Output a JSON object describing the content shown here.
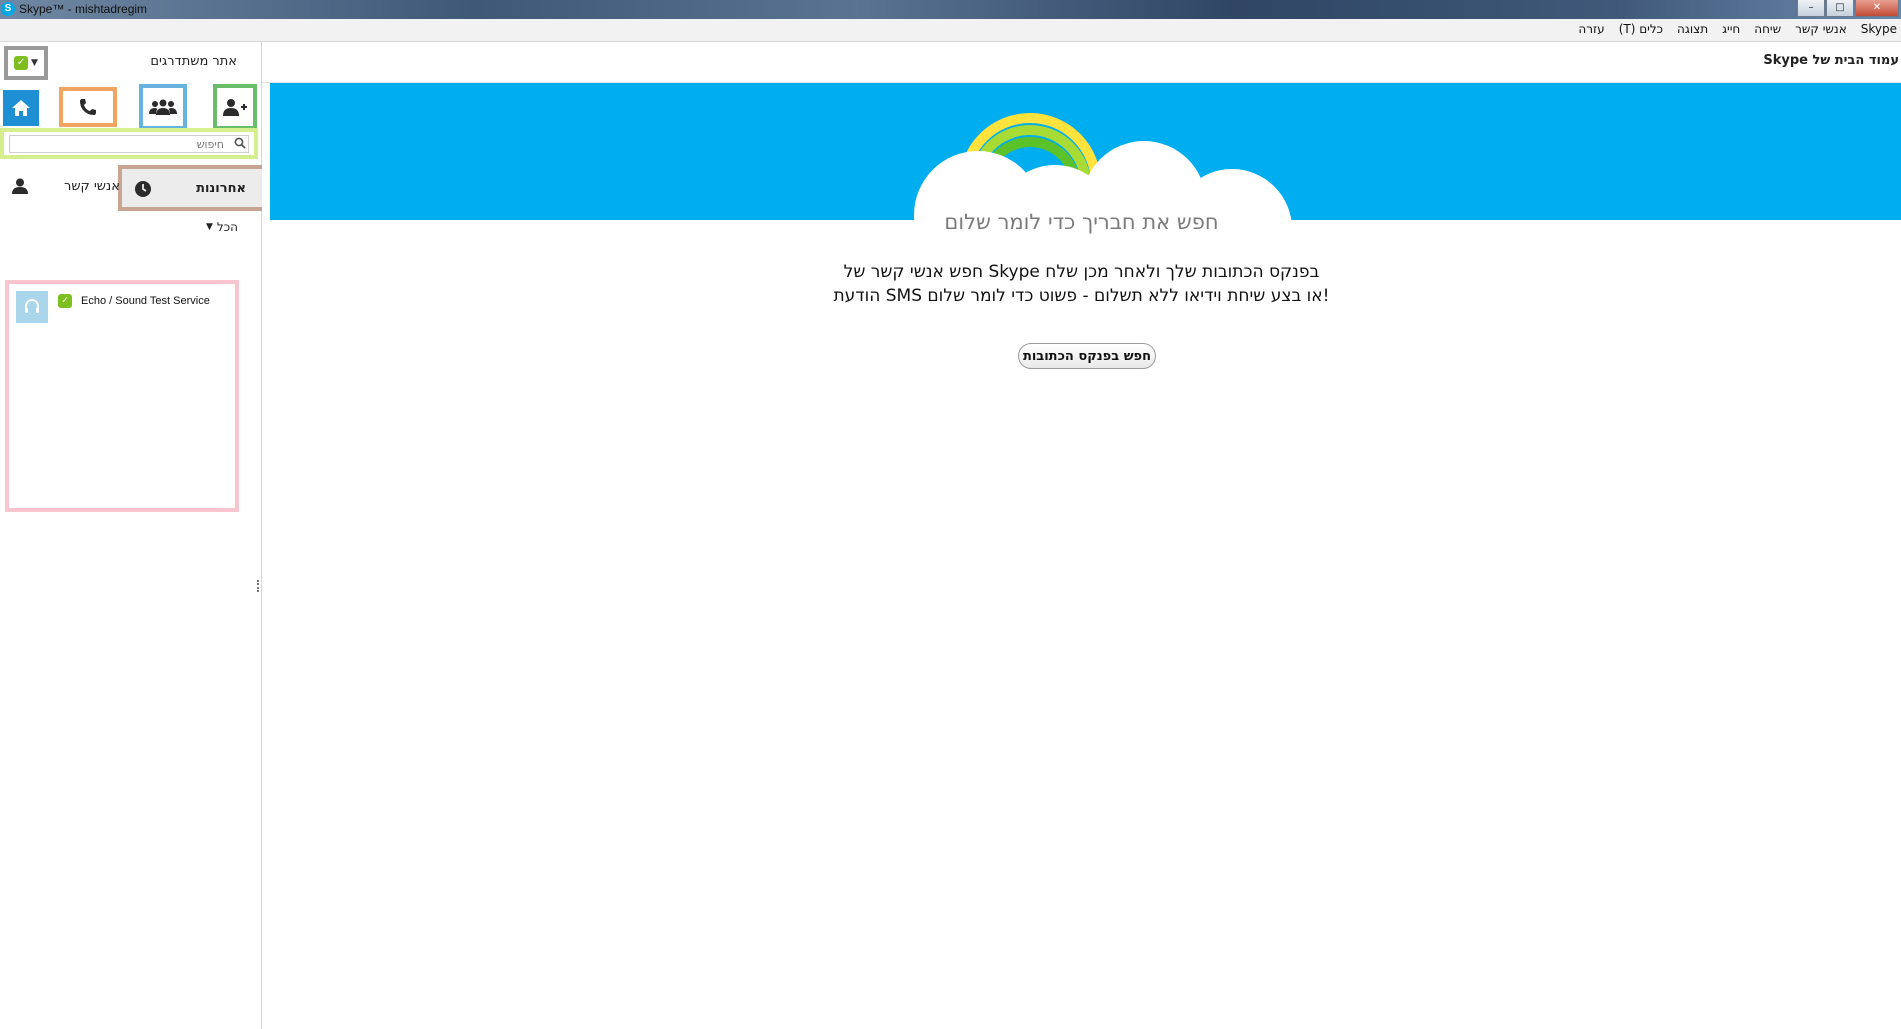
{
  "window": {
    "title": "Skype™ - mishtadregim",
    "logo_letter": "S",
    "minimize": "–",
    "maximize": "□",
    "close": "✕"
  },
  "menu": {
    "items": [
      "Skype",
      "אנשי קשר",
      "שיחה",
      "חייג",
      "תצוגה",
      "כלים (T)",
      "עזרה"
    ]
  },
  "sidebar": {
    "username": "אתר משתדרגים",
    "status_icon": "skype-online-leaf-icon",
    "search": {
      "placeholder": "חיפוש",
      "value": ""
    },
    "tabs": {
      "recent": "אחרונות",
      "contacts": "אנשי קשר"
    },
    "filter": "הכל",
    "contacts": [
      {
        "name": "Echo / Sound Test Service",
        "status": "online"
      }
    ]
  },
  "main": {
    "header": "עמוד הבית של Skype",
    "headline": "חפש את חבריך כדי לומר שלום",
    "body_line1": "בפנקס הכתובות שלך ולאחר מכן שלח  Skype חפש אנשי קשר של",
    "body_line2": "!או בצע שיחת וידיאו ללא תשלום - פשוט כדי לומר שלום SMS הודעת",
    "button": "חפש בפנקס הכתובות"
  },
  "colors": {
    "banner": "#00aeef",
    "home_button": "#1e8fd2",
    "online": "#7cbf1f"
  }
}
